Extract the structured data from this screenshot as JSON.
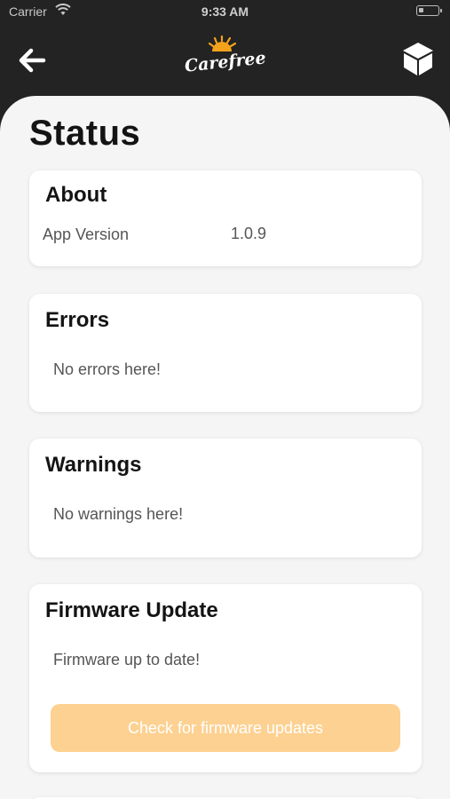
{
  "status_bar": {
    "carrier": "Carrier",
    "time": "9:33 AM"
  },
  "navbar": {
    "logo_text": "Carefree",
    "back_icon": "arrow-left-icon",
    "right_icon": "cube-icon"
  },
  "page": {
    "title": "Status"
  },
  "about": {
    "title": "About",
    "app_version_label": "App Version",
    "app_version_value": "1.0.9"
  },
  "errors": {
    "title": "Errors",
    "message": "No errors here!"
  },
  "warnings": {
    "title": "Warnings",
    "message": "No warnings here!"
  },
  "firmware": {
    "title": "Firmware Update",
    "message": "Firmware up to date!",
    "button_label": "Check for firmware updates"
  },
  "colors": {
    "header_bg": "#232323",
    "sheet_bg": "#f5f5f5",
    "button_bg": "#fdd191",
    "logo_accent": "#f4a21c"
  }
}
